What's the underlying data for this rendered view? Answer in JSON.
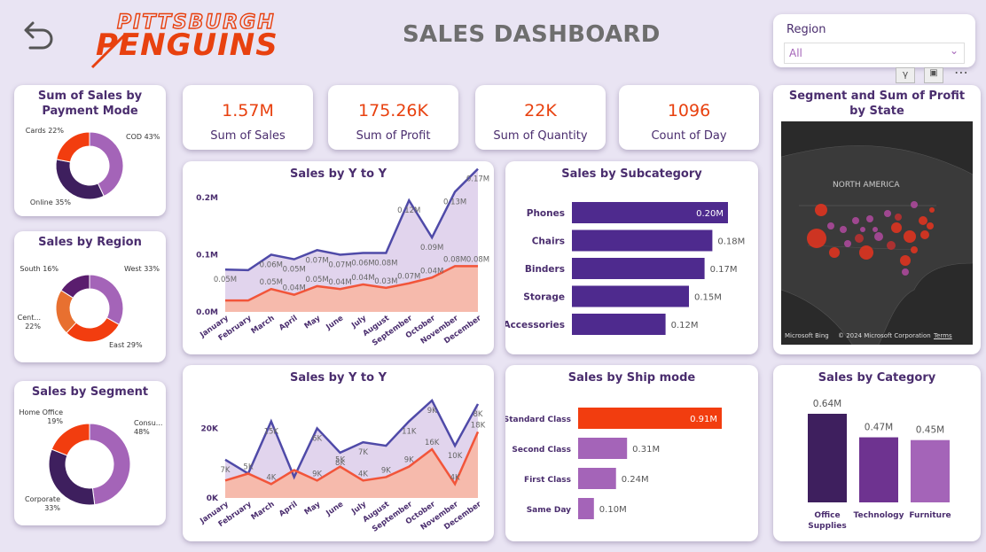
{
  "header": {
    "title": "SALES DASHBOARD",
    "logo_top": "PITTSBURGH",
    "logo_bottom": "PENGUINS",
    "region_filter": {
      "label": "Region",
      "value": "All"
    }
  },
  "colors": {
    "accent": "#e8410f",
    "purple_dark": "#3e1f5e",
    "purple": "#5b3a9a",
    "lilac": "#a464b8",
    "area_top": "#d9c9e8",
    "area_bottom": "#f7b4a3",
    "line_top": "#4f4aa8",
    "line_bottom": "#f2553a"
  },
  "kpis": [
    {
      "value": "1.57M",
      "label": "Sum of Sales"
    },
    {
      "value": "175.26K",
      "label": "Sum of Profit"
    },
    {
      "value": "22K",
      "label": "Sum of Quantity"
    },
    {
      "value": "1096",
      "label": "Count of Day"
    }
  ],
  "chart_data": [
    {
      "type": "pie",
      "id": "payment",
      "title": "Sum of Sales by Payment Mode",
      "slices": [
        {
          "label": "COD 43%",
          "value": 43,
          "color": "#a464b8"
        },
        {
          "label": "Online 35%",
          "value": 35,
          "color": "#3e1f5e"
        },
        {
          "label": "Cards 22%",
          "value": 22,
          "color": "#f23d0f"
        }
      ]
    },
    {
      "type": "pie",
      "id": "region",
      "title": "Sales by Region",
      "slices": [
        {
          "label": "West 33%",
          "value": 33,
          "color": "#a464b8"
        },
        {
          "label": "East 29%",
          "value": 29,
          "color": "#f23d0f"
        },
        {
          "label": "Cent... 22%",
          "value": 22,
          "color": "#e87030"
        },
        {
          "label": "South 16%",
          "value": 16,
          "color": "#5a1d6e"
        }
      ]
    },
    {
      "type": "pie",
      "id": "segment",
      "title": "Sales by Segment",
      "slices": [
        {
          "label": "Consu... 48%",
          "value": 48,
          "color": "#a464b8"
        },
        {
          "label": "Corporate 33%",
          "value": 33,
          "color": "#3e1f5e"
        },
        {
          "label": "Home Office 19%",
          "value": 19,
          "color": "#f23d0f"
        }
      ]
    },
    {
      "type": "area",
      "id": "yoy_sales",
      "title": "Sales by Y to Y",
      "categories": [
        "January",
        "February",
        "March",
        "April",
        "May",
        "June",
        "July",
        "August",
        "September",
        "October",
        "November",
        "December"
      ],
      "ylim": [
        0,
        0.22
      ],
      "yticks": [
        "0.0M",
        "0.1M",
        "0.2M"
      ],
      "ytick_values": [
        0,
        0.1,
        0.2
      ],
      "series": [
        {
          "values": [
            0.074,
            0.073,
            0.1,
            0.092,
            0.108,
            0.1,
            0.103,
            0.103,
            0.195,
            0.13,
            0.21,
            0.25
          ],
          "labels": [
            "0.05M",
            "",
            "0.06M",
            "0.05M",
            "0.07M",
            "0.07M",
            "0.06M",
            "0.08M",
            "0.12M",
            "0.09M",
            "0.13M",
            "0.17M"
          ]
        },
        {
          "values": [
            0.02,
            0.02,
            0.04,
            0.03,
            0.045,
            0.04,
            0.048,
            0.042,
            0.05,
            0.06,
            0.08,
            0.08
          ],
          "labels": [
            "",
            "",
            "0.05M",
            "0.04M",
            "0.05M",
            "0.04M",
            "0.04M",
            "0.03M",
            "0.07M",
            "0.04M",
            "0.08M",
            "0.08M"
          ]
        }
      ]
    },
    {
      "type": "bar",
      "id": "subcategory",
      "title": "Sales by Subcategory",
      "categories": [
        "Phones",
        "Chairs",
        "Binders",
        "Storage",
        "Accessories"
      ],
      "values": [
        0.2,
        0.18,
        0.17,
        0.15,
        0.12
      ],
      "labels": [
        "0.20M",
        "0.18M",
        "0.17M",
        "0.15M",
        "0.12M"
      ]
    },
    {
      "type": "area",
      "id": "yoy_qty",
      "title": "Sales by Y to Y",
      "categories": [
        "January",
        "February",
        "March",
        "April",
        "May",
        "June",
        "July",
        "August",
        "September",
        "October",
        "November",
        "December"
      ],
      "ylim": [
        0,
        28
      ],
      "yticks": [
        "0K",
        "20K"
      ],
      "ytick_values": [
        0,
        20
      ],
      "series": [
        {
          "values": [
            11,
            7,
            22,
            6,
            20,
            13,
            16,
            15,
            22,
            28,
            15,
            27
          ],
          "labels": [
            "7K",
            "",
            "15K",
            "",
            "6K",
            "8K",
            "7K",
            "",
            "11K",
            "9K",
            "10K",
            "8K"
          ]
        },
        {
          "values": [
            5,
            7,
            4,
            8,
            5,
            9,
            5,
            6,
            9,
            14,
            4,
            19
          ],
          "labels": [
            "",
            "5K",
            "4K",
            "",
            "9K",
            "5K",
            "4K",
            "9K",
            "9K",
            "16K",
            "4K",
            "18K"
          ]
        }
      ]
    },
    {
      "type": "bar",
      "id": "shipmode",
      "title": "Sales by Ship mode",
      "categories": [
        "Standard Class",
        "Second Class",
        "First Class",
        "Same Day"
      ],
      "values": [
        0.91,
        0.31,
        0.24,
        0.1
      ],
      "labels": [
        "0.91M",
        "0.31M",
        "0.24M",
        "0.10M"
      ],
      "colors": [
        "#f23d0f",
        "#a464b8",
        "#a464b8",
        "#a464b8"
      ]
    },
    {
      "type": "bar",
      "id": "category",
      "title": "Sales by Category",
      "categories": [
        "Office Supplies",
        "Technology",
        "Furniture"
      ],
      "values": [
        0.64,
        0.47,
        0.45
      ],
      "labels": [
        "0.64M",
        "0.47M",
        "0.45M"
      ],
      "colors": [
        "#3e1f5e",
        "#6e3390",
        "#a464b8"
      ]
    }
  ],
  "map": {
    "title": "Segment and Sum of Profit by State",
    "region_label": "NORTH AMERICA",
    "bing": "Microsoft Bing",
    "copyright": "© 2024 Microsoft Corporation",
    "terms": "Terms"
  }
}
